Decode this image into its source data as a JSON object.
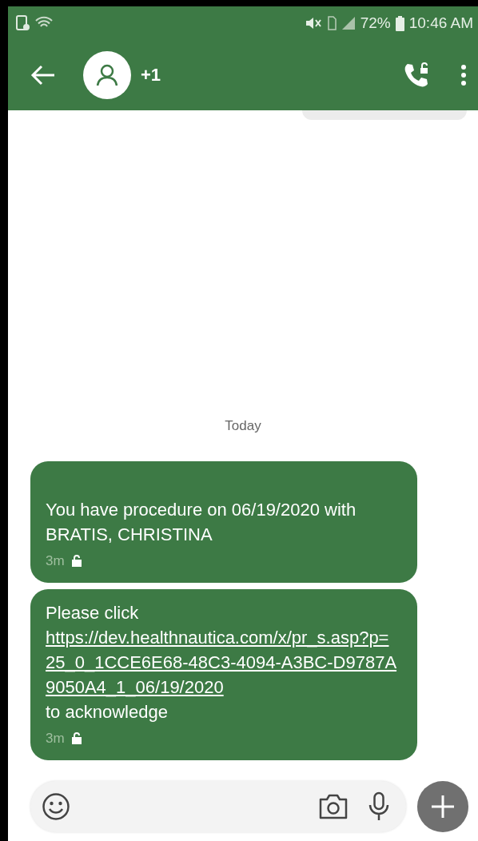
{
  "status_bar": {
    "battery": "72%",
    "time": "10:46 AM"
  },
  "header": {
    "contact": "+1"
  },
  "conversation": {
    "date_separator": "Today",
    "messages": [
      {
        "parts": [
          {
            "kind": "text",
            "text": "You have procedure on 06/19/2020 with BRATIS, CHRISTINA"
          }
        ],
        "time": "3m"
      },
      {
        "parts": [
          {
            "kind": "text",
            "text": "Please click"
          },
          {
            "kind": "link",
            "text": "https://dev.healthnautica.com/x/pr_s.asp?p=25_0_1CCE6E68-48C3-4094-A3BC-D9787A9050A4_1_06/19/2020"
          },
          {
            "kind": "text",
            "text": "to acknowledge"
          }
        ],
        "time": "3m"
      }
    ]
  }
}
